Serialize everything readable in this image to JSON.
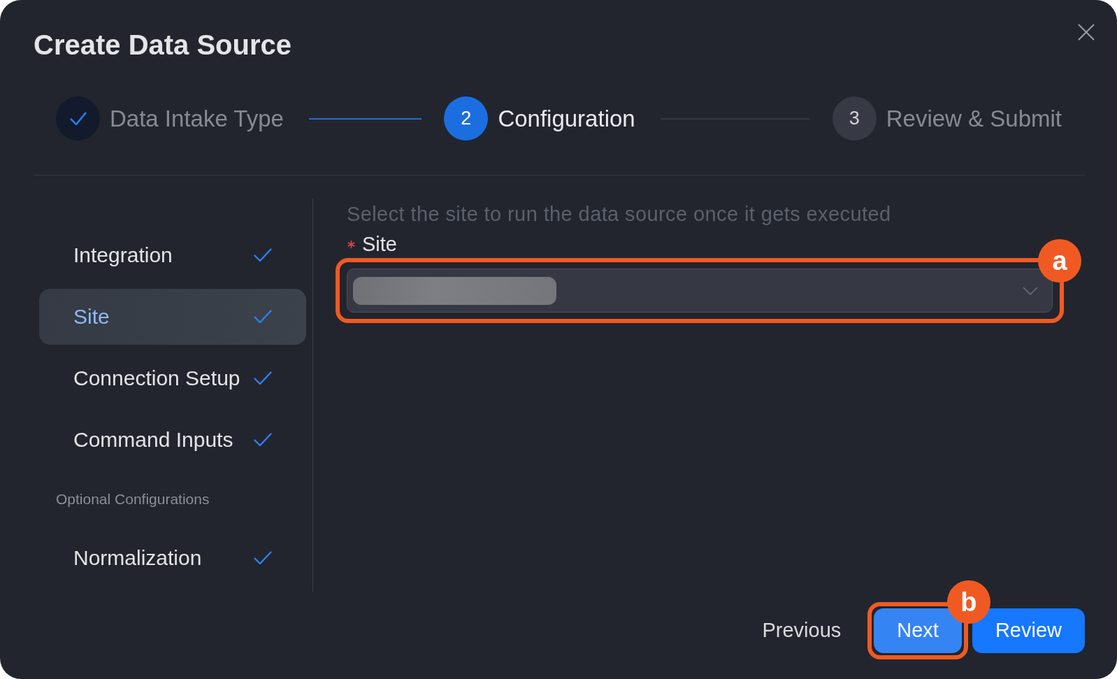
{
  "dialog": {
    "title": "Create Data Source"
  },
  "steps": [
    {
      "label": "Data Intake Type",
      "done": true,
      "selected": false
    },
    {
      "number": "2",
      "label": "Configuration",
      "done": false,
      "selected": true
    },
    {
      "number": "3",
      "label": "Review & Submit",
      "done": false,
      "selected": false
    }
  ],
  "sidebar": {
    "items": [
      {
        "kind": "item",
        "label": "Integration",
        "selected": false,
        "checked": true
      },
      {
        "kind": "item",
        "label": "Site",
        "selected": true,
        "checked": true
      },
      {
        "kind": "item",
        "label": "Connection Setup",
        "selected": false,
        "checked": true
      },
      {
        "kind": "item",
        "label": "Command Inputs",
        "selected": false,
        "checked": true
      },
      {
        "kind": "heading",
        "label": "Optional Configurations"
      },
      {
        "kind": "item",
        "label": "Normalization",
        "selected": false,
        "checked": true
      }
    ]
  },
  "form": {
    "description": "Select the site to run the data source once it gets executed",
    "field": {
      "label": "Site",
      "required": true,
      "value_blurred": true,
      "annotation": "a"
    }
  },
  "buttons": [
    {
      "kind": "text",
      "label": "Previous"
    },
    {
      "kind": "secondary",
      "label": "Next",
      "annotation": "b"
    },
    {
      "kind": "primary",
      "label": "Review"
    }
  ]
}
